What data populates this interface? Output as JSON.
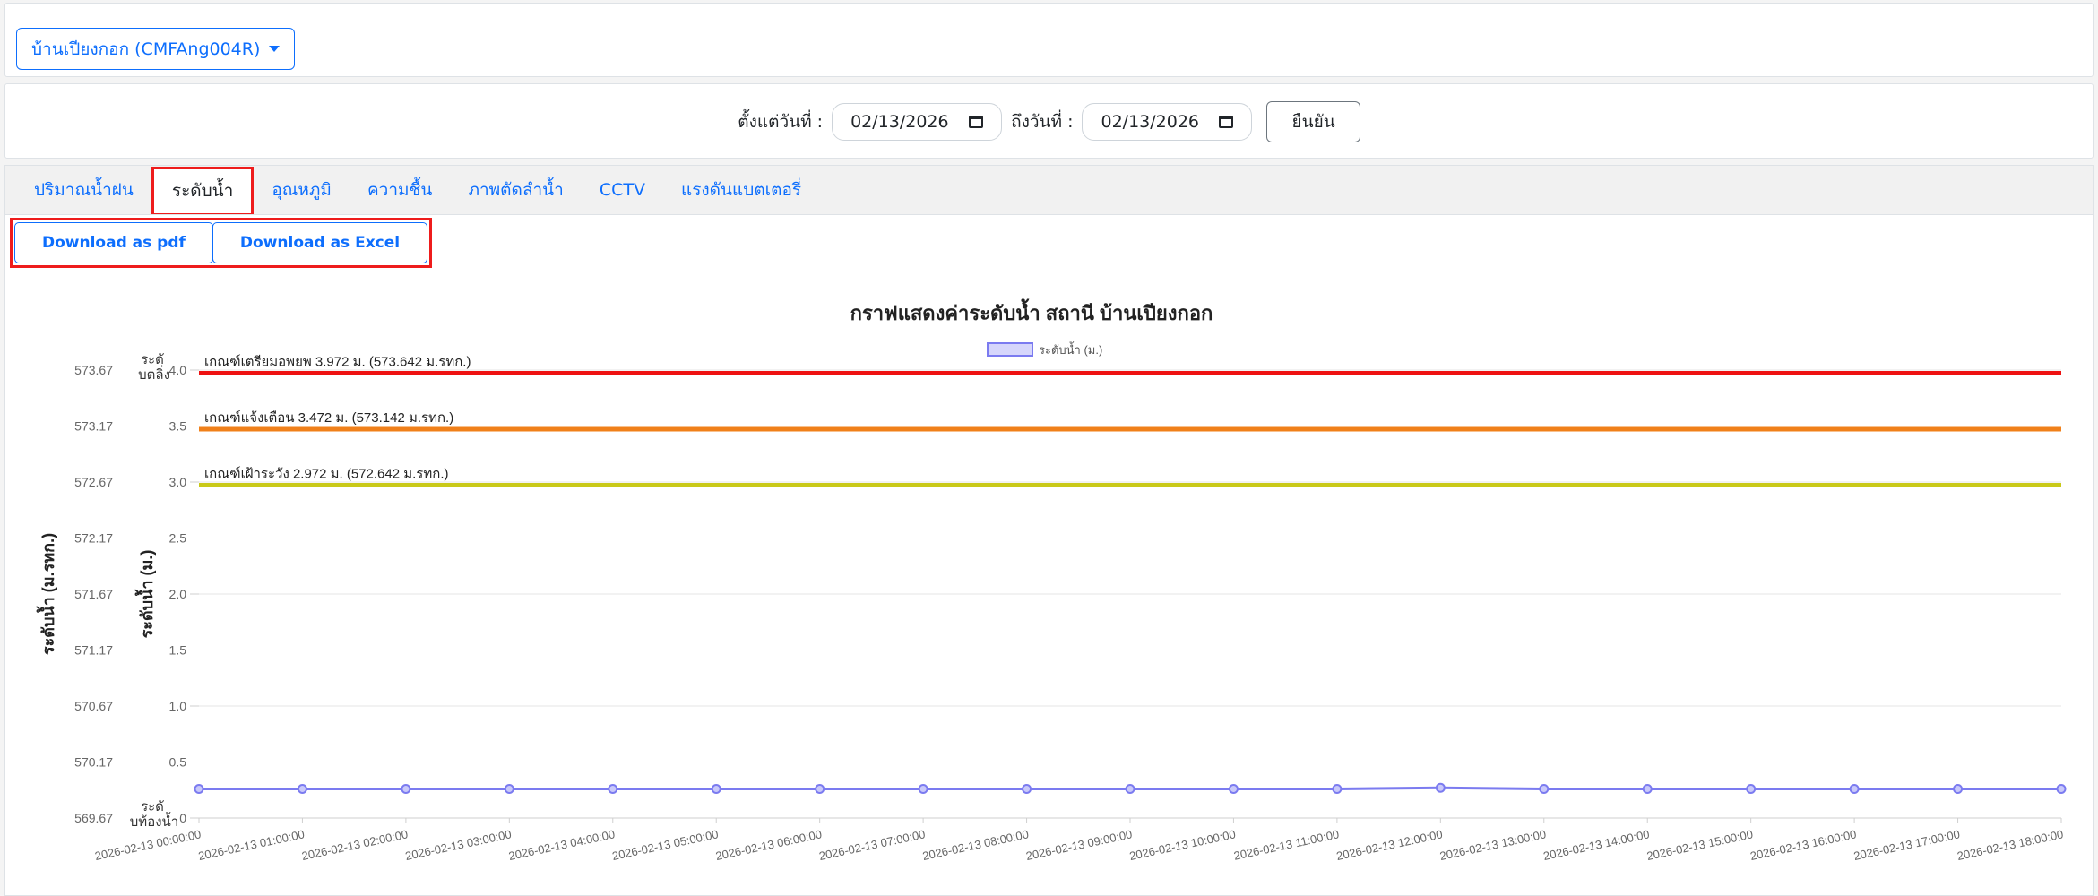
{
  "station_selector": {
    "label": "บ้านเปียงกอก (CMFAng004R)"
  },
  "date_filter": {
    "from_label": "ตั้งแต่วันที่ :",
    "from_value": "02/13/2026",
    "to_label": "ถึงวันที่ :",
    "to_value": "02/13/2026",
    "confirm_label": "ยืนยัน"
  },
  "tabs": [
    {
      "label": "ปริมาณน้ำฝน",
      "active": false
    },
    {
      "label": "ระดับน้ำ",
      "active": true
    },
    {
      "label": "อุณหภูมิ",
      "active": false
    },
    {
      "label": "ความชื้น",
      "active": false
    },
    {
      "label": "ภาพตัดลำน้ำ",
      "active": false
    },
    {
      "label": "CCTV",
      "active": false
    },
    {
      "label": "แรงดันแบตเตอรี่",
      "active": false
    }
  ],
  "downloads": {
    "pdf_label": "Download as pdf",
    "excel_label": "Download as Excel"
  },
  "chart_data": {
    "type": "line",
    "title": "กราฟแสดงค่าระดับน้ำ สถานี บ้านเปียงกอก",
    "legend": {
      "label": "ระดับน้ำ (ม.)",
      "position": "top-center"
    },
    "y_left_label": "ระดับน้ำ (ม.รทก.)",
    "y_right_label": "ระดับน้ำ (ม.)",
    "y_left_ticks": [
      "569.67",
      "570.17",
      "570.67",
      "571.17",
      "571.67",
      "572.17",
      "572.67",
      "573.17",
      "573.67"
    ],
    "y_right_ticks": [
      "0",
      "0.5",
      "1.0",
      "1.5",
      "2.0",
      "2.5",
      "3.0",
      "3.5",
      "4.0"
    ],
    "ylim": [
      0,
      4
    ],
    "y_top_label": "ระดับตลิ่ง",
    "y_bottom_label": "ระดับท้องน้ำ",
    "grid": true,
    "x": [
      "2026-02-13 00:00:00",
      "2026-02-13 01:00:00",
      "2026-02-13 02:00:00",
      "2026-02-13 03:00:00",
      "2026-02-13 04:00:00",
      "2026-02-13 05:00:00",
      "2026-02-13 06:00:00",
      "2026-02-13 07:00:00",
      "2026-02-13 08:00:00",
      "2026-02-13 09:00:00",
      "2026-02-13 10:00:00",
      "2026-02-13 11:00:00",
      "2026-02-13 12:00:00",
      "2026-02-13 13:00:00",
      "2026-02-13 14:00:00",
      "2026-02-13 15:00:00",
      "2026-02-13 16:00:00",
      "2026-02-13 17:00:00",
      "2026-02-13 18:00:00"
    ],
    "series": [
      {
        "name": "ระดับน้ำ (ม.)",
        "color": "#7b7bf0",
        "values": [
          0.26,
          0.26,
          0.26,
          0.26,
          0.26,
          0.26,
          0.26,
          0.26,
          0.26,
          0.26,
          0.26,
          0.26,
          0.27,
          0.26,
          0.26,
          0.26,
          0.26,
          0.26,
          0.26
        ]
      }
    ],
    "thresholds": [
      {
        "label": "เกณฑ์เตรียมอพยพ 3.972 ม. (573.642 ม.รทก.)",
        "value": 3.972,
        "color": "#ee1111"
      },
      {
        "label": "เกณฑ์แจ้งเตือน   3.472 ม. (573.142 ม.รทก.)",
        "value": 3.472,
        "color": "#f0801a"
      },
      {
        "label": "เกณฑ์เฝ้าระวัง    2.972 ม. (572.642 ม.รทก.)",
        "value": 2.972,
        "color": "#c9c918"
      }
    ]
  }
}
